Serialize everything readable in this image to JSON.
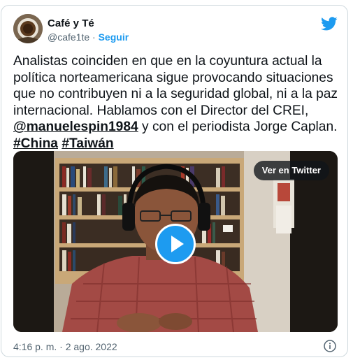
{
  "author": {
    "name": "Café y Té",
    "handle": "@cafe1te",
    "separator": "·",
    "follow_label": "Seguir"
  },
  "tweet": {
    "text_before": "Analistas coinciden en que en la coyuntura actual la política norteamericana sigue provocando situaciones que no contribuyen ni a la seguridad global, ni a la paz internacional. Hablamos con el Director del CREI, ",
    "mention": "@manuelespin1984",
    "text_middle": " y con el periodista Jorge Caplan. ",
    "hashtags": [
      "#China",
      "#Taiwán"
    ]
  },
  "video": {
    "open_label": "Ver en Twitter"
  },
  "footer": {
    "timestamp": "4:16 p. m. · 2 ago. 2022"
  },
  "colors": {
    "accent": "#1d9bf0",
    "text": "#0f1419",
    "muted": "#536471",
    "border": "#cfd9de"
  },
  "icons": {
    "brand": "twitter-bird-icon",
    "play": "play-icon",
    "info": "info-icon"
  }
}
